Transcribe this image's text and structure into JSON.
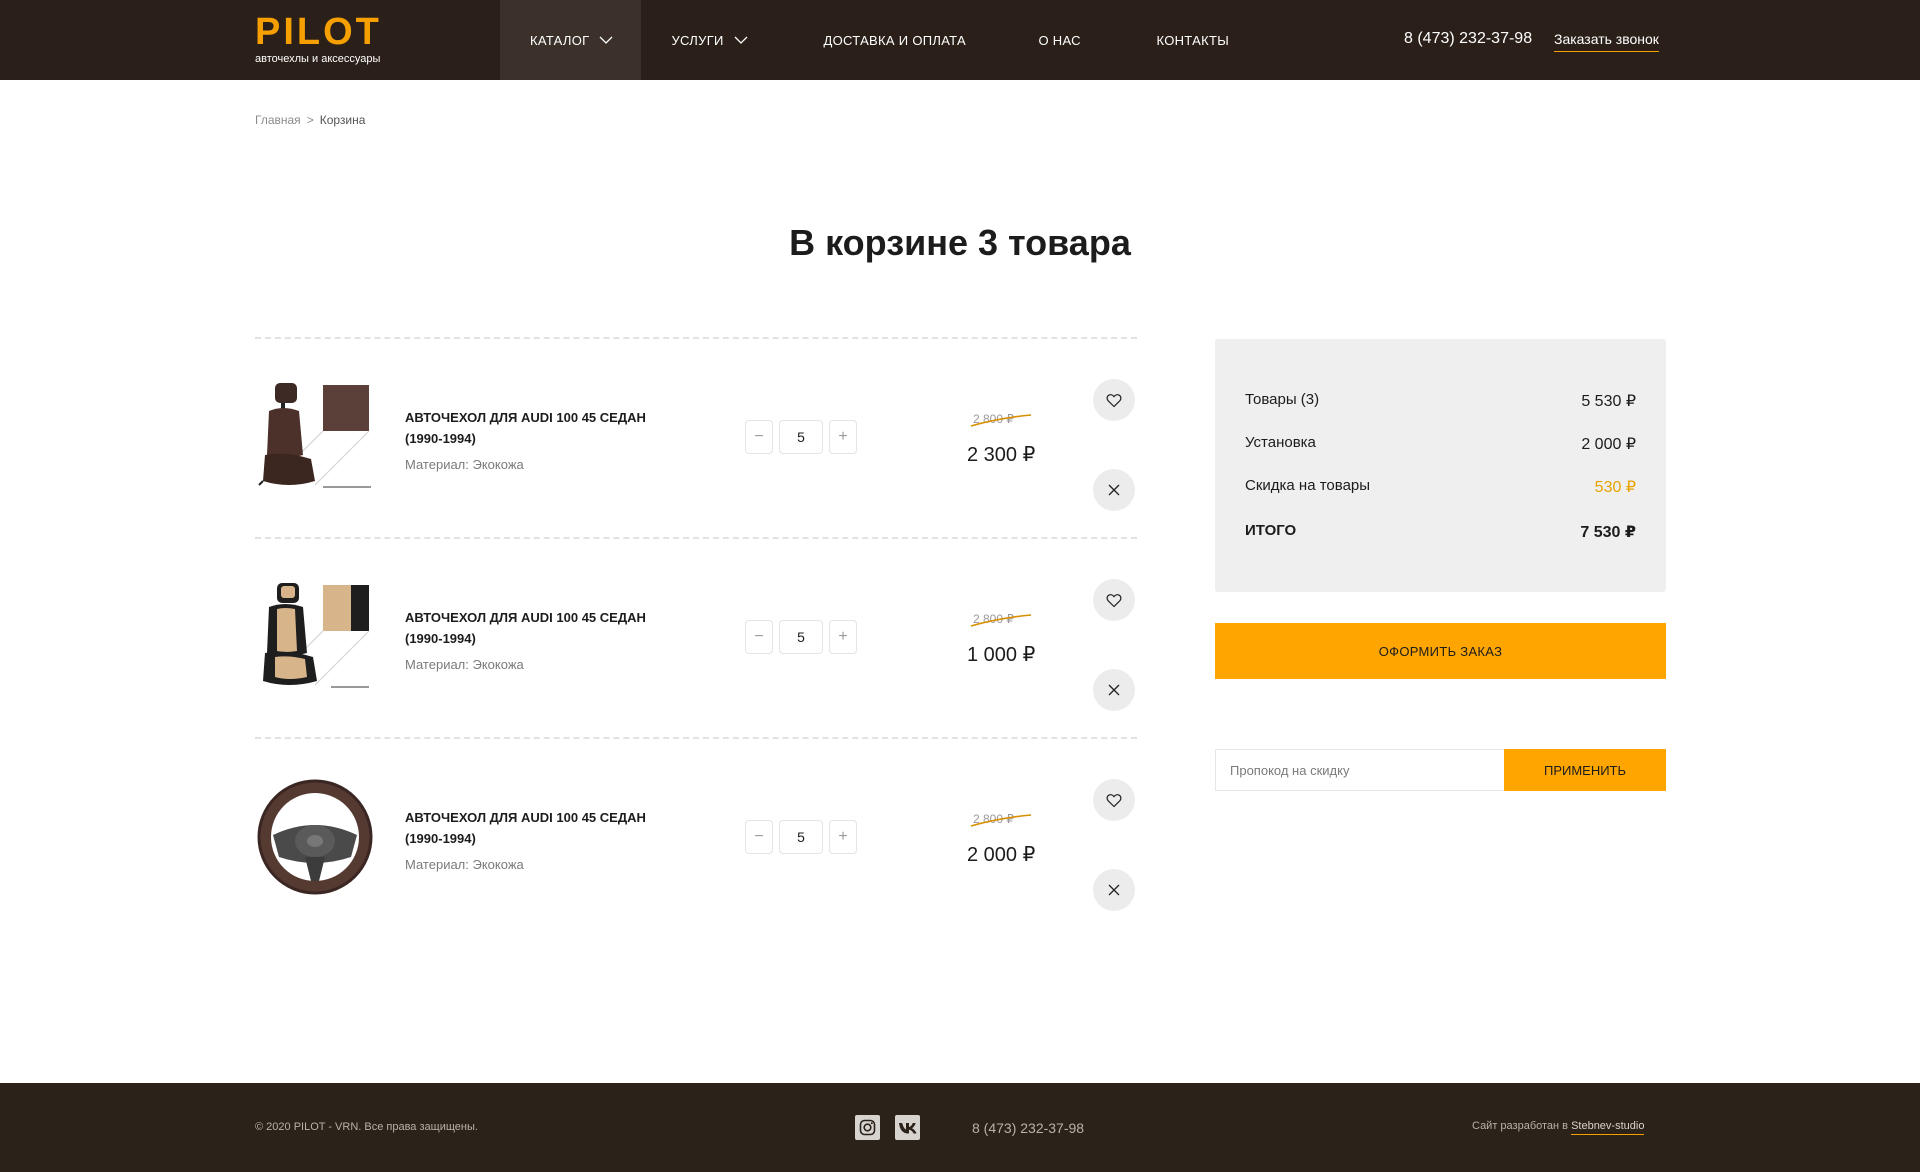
{
  "header": {
    "logo_title": "PILOT",
    "logo_subtitle": "авточехлы и аксессуары",
    "nav": [
      {
        "label": "КАТАЛОГ",
        "has_dropdown": true,
        "active": true
      },
      {
        "label": "УСЛУГИ",
        "has_dropdown": true,
        "active": false
      },
      {
        "label": "ДОСТАВКА И ОПЛАТА",
        "has_dropdown": false,
        "active": false
      },
      {
        "label": "О НАС",
        "has_dropdown": false,
        "active": false
      },
      {
        "label": "КОНТАКТЫ",
        "has_dropdown": false,
        "active": false
      }
    ],
    "phone": "8 (473) 232-37-98",
    "callback_label": "Заказать звонок"
  },
  "breadcrumb": {
    "home": "Главная",
    "separator": ">",
    "current": "Корзина"
  },
  "page_title": "В корзине 3 товара",
  "cart_items": [
    {
      "name": "АВТОЧЕХОЛ ДЛЯ AUDI 100 45 СЕДАН (1990-1994)",
      "material": "Материал: Экокожа",
      "quantity": "5",
      "old_price": "2 800 ₽",
      "price": "2 300 ₽",
      "image_icon": "brown-seat-cover-image"
    },
    {
      "name": "АВТОЧЕХОЛ ДЛЯ AUDI 100 45 СЕДАН (1990-1994)",
      "material": "Материал: Экокожа",
      "quantity": "5",
      "old_price": "2 800 ₽",
      "price": "1 000 ₽",
      "image_icon": "beige-seat-cover-image"
    },
    {
      "name": "АВТОЧЕХОЛ ДЛЯ AUDI 100 45 СЕДАН (1990-1994)",
      "material": "Материал: Экокожа",
      "quantity": "5",
      "old_price": "2 800 ₽",
      "price": "2 000 ₽",
      "image_icon": "steering-wheel-cover-image"
    }
  ],
  "quantity_controls": {
    "minus": "−",
    "plus": "+"
  },
  "summary": {
    "goods_label": "Товары (3)",
    "goods_value": "5 530 ₽",
    "install_label": "Установка",
    "install_value": "2 000 ₽",
    "discount_label": "Скидка на товары",
    "discount_value": "530 ₽",
    "total_label": "ИТОГО",
    "total_value": "7 530 ₽"
  },
  "order_button": "ОФОРМИТЬ ЗАКАЗ",
  "promo": {
    "placeholder": "Пропокод на скидку",
    "value": "",
    "apply_label": "ПРИМЕНИТЬ"
  },
  "footer": {
    "copyright": "© 2020 PILOT - VRN. Все права защищены.",
    "social": [
      "instagram-icon",
      "vk-icon"
    ],
    "phone": "8 (473) 232-37-98",
    "credit_prefix": "Сайт разработан в",
    "credit_link": "Stebnev-studio"
  },
  "colors": {
    "accent": "#ffa500",
    "header_bg": "#2b2019",
    "footer_bg": "#2b2219",
    "summary_bg": "#efefef",
    "discount_text": "#e8a200"
  }
}
